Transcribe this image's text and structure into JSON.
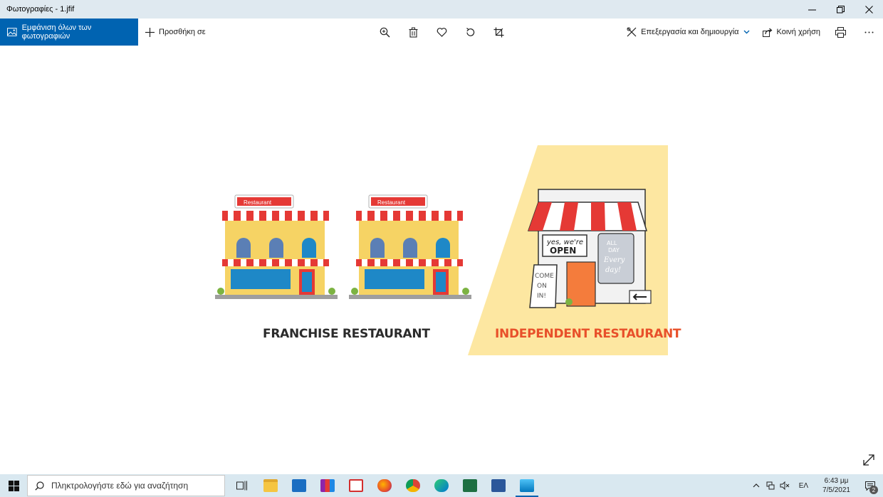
{
  "window": {
    "title": "Φωτογραφίες - 1.jfif"
  },
  "toolbar": {
    "view_all_label": "Εμφάνιση όλων των φωτογραφιών",
    "add_to_label": "Προσθήκη σε",
    "edit_create_label": "Επεξεργασία και δημιουργία",
    "share_label": "Κοινή χρήση"
  },
  "image": {
    "left_caption": "FRANCHISE RESTAURANT",
    "right_caption": "INDEPENDENT RESTAURANT",
    "sign_text": "Restaurant",
    "shop_sign_top": "yes, we're",
    "shop_sign_bottom": "OPEN",
    "window_text": [
      "ALL",
      "DAY",
      "Every",
      "day!"
    ],
    "board_text": [
      "COME",
      "ON",
      "IN!"
    ],
    "colors": {
      "accent_orange": "#e8502a",
      "panel_yellow": "#fde7a1",
      "awning_red": "#e53935",
      "building_yellow": "#f6d364"
    }
  },
  "taskbar": {
    "search_placeholder": "Πληκτρολογήστε εδώ για αναζήτηση",
    "language": "ΕΛ",
    "time": "6:43 μμ",
    "date": "7/5/2021",
    "notification_count": "2"
  }
}
